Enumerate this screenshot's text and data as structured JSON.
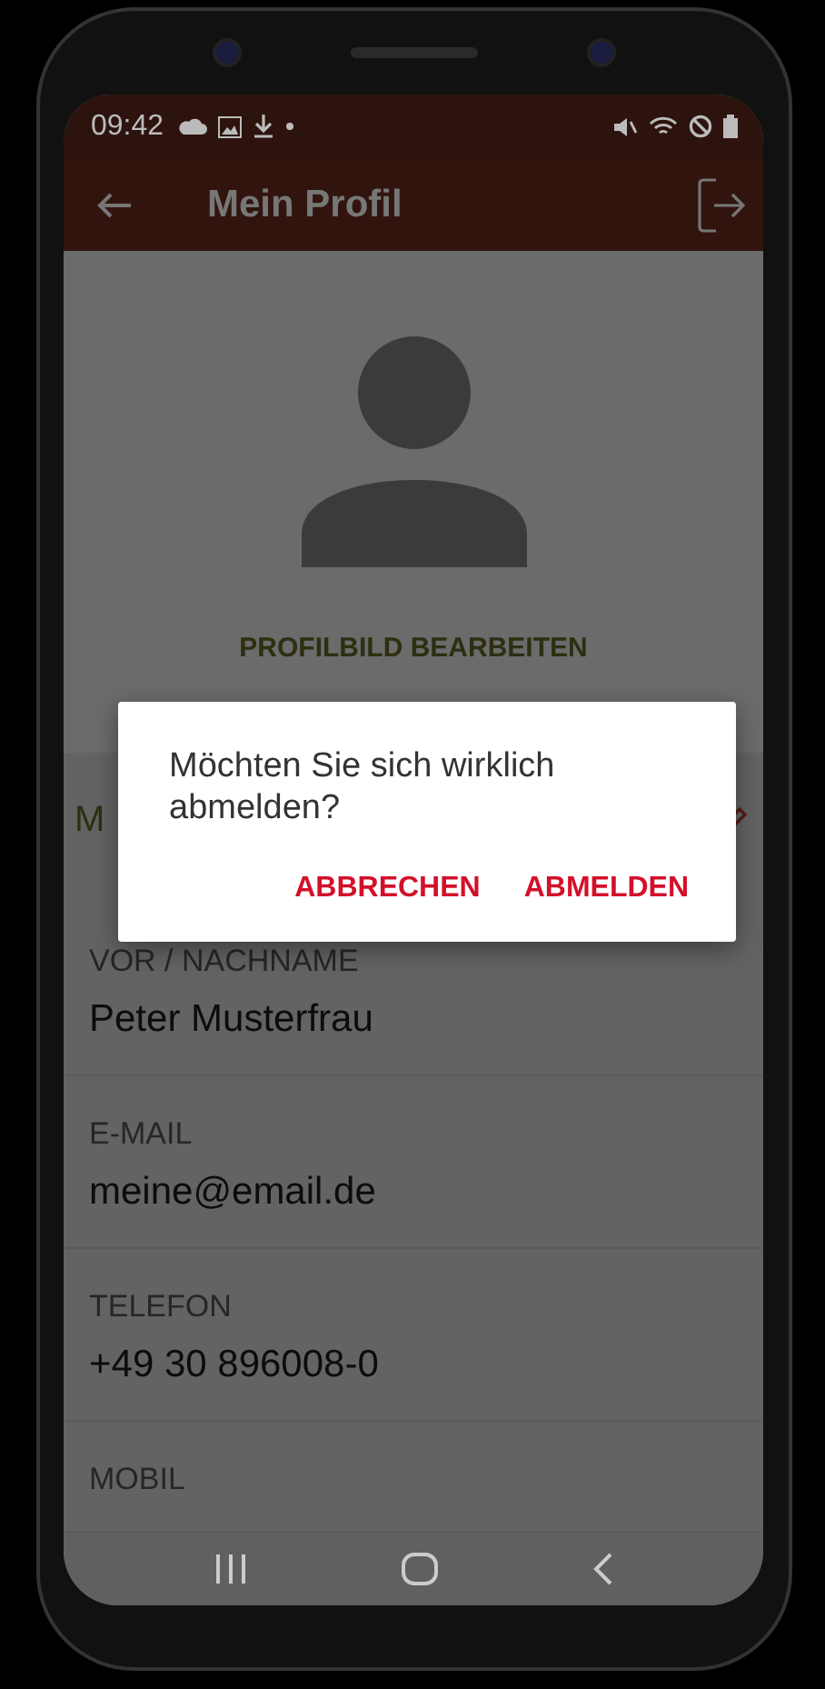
{
  "status_bar": {
    "time": "09:42"
  },
  "app_bar": {
    "title": "Mein Profil"
  },
  "profile": {
    "edit_photo": "PROFILBILD BEARBEITEN"
  },
  "section": {
    "title": "M"
  },
  "fields": [
    {
      "label": "VOR / NACHNAME",
      "value": "Peter Musterfrau"
    },
    {
      "label": "E-MAIL",
      "value": "meine@email.de"
    },
    {
      "label": "TELEFON",
      "value": "+49 30 896008-0"
    },
    {
      "label": "MOBIL"
    }
  ],
  "dialog": {
    "message": "Möchten Sie sich wirklich abmelden?",
    "buttons": [
      "ABBRECHEN",
      "ABMELDEN"
    ]
  }
}
